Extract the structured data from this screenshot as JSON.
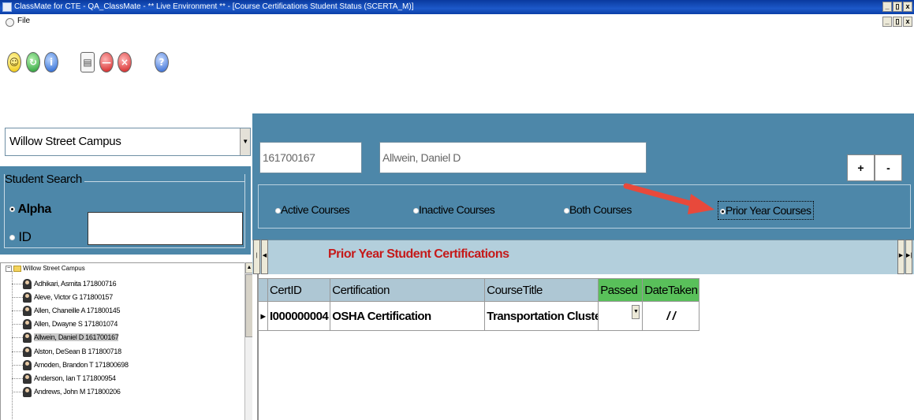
{
  "window": {
    "title": "ClassMate for CTE - QA_ClassMate - ** Live Environment ** - [Course Certifications Student Status (SCERTA_M)]",
    "controls": [
      "_",
      "̅",
      "x"
    ]
  },
  "menu": {
    "file_label": "File"
  },
  "toolbar": {
    "icons": [
      "smiley-icon",
      "green-refresh-icon",
      "info-icon",
      "clipboard-icon",
      "stop-icon",
      "delete-icon",
      "help-icon"
    ]
  },
  "left": {
    "campus": "Willow Street Campus",
    "search_legend": "Student Search",
    "opt_alpha": "Alpha",
    "opt_id": "ID",
    "search_value": "",
    "tree_root": "Willow Street Campus",
    "students": [
      "Adhikari, Asmita  171800716",
      "Aleve, Victor G 171800157",
      "Allen, Chaneille A 171800145",
      "Allen, Dwayne S 171801074",
      "Allwein, Daniel D 161700167",
      "Alston, DeSean B 171800718",
      "Amoden, Brandon T 171800698",
      "Anderson, Ian T 171800954",
      "Andrews, John M 171800206"
    ],
    "selected_student_index": 4
  },
  "right": {
    "student_id": "161700167",
    "student_name": "Allwein, Daniel D",
    "plus_label": "+",
    "minus_label": "-",
    "options": {
      "active": "Active Courses",
      "inactive": "Inactive Courses",
      "both": "Both Courses",
      "prior": "Prior Year Courses"
    },
    "selected_option": "prior",
    "grid_caption": "Prior Year Student Certifications",
    "columns": [
      "CertID",
      "Certification",
      "CourseTitle",
      "Passed",
      "DateTaken"
    ],
    "rows": [
      {
        "cert_id": "I000000004",
        "certification": "OSHA Certification",
        "course_title": "Transportation Cluster - I",
        "passed": "",
        "date_taken": "/ /"
      }
    ]
  },
  "colors": {
    "panel_blue": "#4d87a9",
    "grid_band": "#b3cfdc",
    "caption_red": "#c51a1a",
    "header_green": "#59c05a",
    "arrow_red": "#e8493b"
  }
}
